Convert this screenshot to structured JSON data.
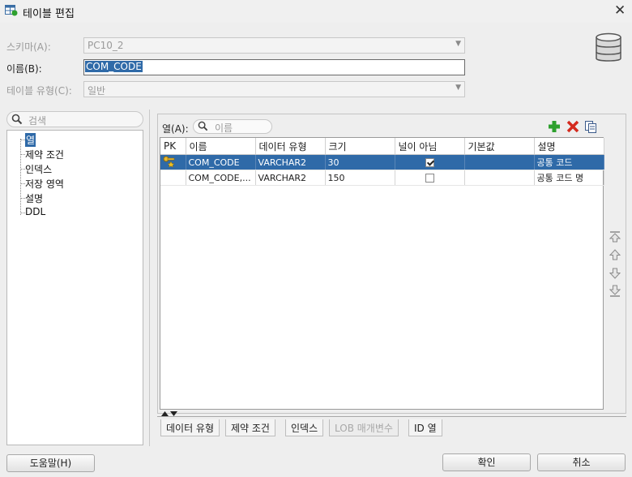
{
  "window": {
    "title": "테이블 편집",
    "close_glyph": "✕"
  },
  "form": {
    "schema_label": "스키마(A):",
    "schema_value": "PC10_2",
    "name_label": "이름(B):",
    "name_value": "COM_CODE",
    "type_label": "테이블 유형(C):",
    "type_value": "일반"
  },
  "left": {
    "search_placeholder": "검색",
    "items": [
      "열",
      "제약 조건",
      "인덱스",
      "저장 영역",
      "설명",
      "DDL"
    ]
  },
  "columns_panel": {
    "label": "열(A):",
    "search_placeholder": "이름",
    "headers": [
      "PK",
      "이름",
      "데이터 유형",
      "크기",
      "널이 아님",
      "기본값",
      "설명"
    ],
    "rows": [
      {
        "name": "COM_CODE",
        "type": "VARCHAR2",
        "size": "30",
        "not_null": true,
        "default": "",
        "desc": "공통 코드",
        "pk": true
      },
      {
        "name": "COM_CODE,...",
        "type": "VARCHAR2",
        "size": "150",
        "not_null": false,
        "default": "",
        "desc": "공통 코드 명",
        "pk": false
      }
    ]
  },
  "bottom_tabs": [
    "데이터 유형",
    "제약 조건",
    "인덱스",
    "LOB 매개변수",
    "ID 열"
  ],
  "buttons": {
    "help": "도움말(H)",
    "ok": "확인",
    "cancel": "취소"
  },
  "colors": {
    "selection": "#2f6aa8",
    "add": "#2ea02e",
    "delete": "#d42a1e"
  }
}
